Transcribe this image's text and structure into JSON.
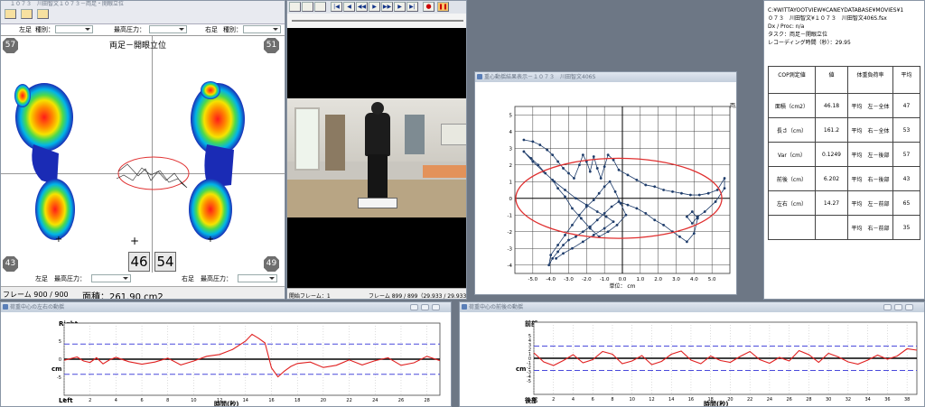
{
  "colors": {
    "accent": "#e02020",
    "track": "#1f3d6b",
    "ellipse": "#e03030",
    "mean": "#000000",
    "band": "#4a4adb",
    "desktop": "#6d7785"
  },
  "foot_window": {
    "title": "１０７３　川田智文１０７３－両足・開眼立位",
    "toolbar_icons": [
      "trace-icon",
      "foot-icon",
      "view-icon"
    ],
    "left_foot_label": "左足",
    "type_label": "種別：",
    "max_pressure_label": "最高圧力：",
    "right_foot_label": "右足",
    "type_label_right": "種別：",
    "display_title": "両足－開眼立位",
    "corner_tl": "57",
    "corner_tr": "51",
    "corner_bl": "43",
    "corner_br": "49",
    "pct_left": "46",
    "pct_right": "54",
    "bottom_left_label": "左足　最高圧力：",
    "bottom_right_label": "右足　最高圧力：",
    "frame_status": "フレーム 900 / 900",
    "area_status": "面積：261.90 cm2"
  },
  "video_window": {
    "controls": [
      "open-icon",
      "copy-icon",
      "save-icon",
      "first-icon",
      "prev-icon",
      "back-icon",
      "play-icon",
      "forward-icon",
      "next-icon",
      "last-icon",
      "record-icon",
      "pause-icon"
    ],
    "start_frame_label": "開始フレーム：1",
    "frame_status": "フレーム 899 / 899（29.933 / 29.933 秒）"
  },
  "cop_window": {
    "title": "重心動揺結果表示－１０７３　川田智文406S",
    "legend": "１０７３\n両足－開眼立位",
    "xlabel": "単位： cm",
    "chart_data": {
      "type": "scatter",
      "title": "",
      "xlabel": "単位： cm",
      "ylabel": "",
      "xlim": [
        -6,
        6
      ],
      "ylim": [
        -4.5,
        5.5
      ],
      "xticks": [
        -5,
        -4,
        -3,
        -2,
        -1,
        0,
        1,
        2,
        3,
        4,
        5
      ],
      "yticks": [
        5,
        4,
        3,
        2,
        1,
        0,
        -1,
        -2,
        -3,
        -4
      ],
      "grid": true,
      "ellipse": {
        "cx": -0.2,
        "cy": 0,
        "rx": 5.75,
        "ry": 2.4
      },
      "x": [
        -5.5,
        -5.0,
        -4.6,
        -4.2,
        -3.9,
        -3.6,
        -3.3,
        -3.0,
        -2.7,
        -2.4,
        -2.2,
        -2.0,
        -1.8,
        -1.6,
        -1.4,
        -1.2,
        -1.0,
        -0.8,
        -0.5,
        -0.2,
        0.3,
        0.8,
        1.3,
        1.8,
        2.3,
        2.8,
        3.3,
        3.8,
        4.3,
        4.8,
        5.3,
        5.7,
        5.7,
        5.2,
        4.6,
        4.2,
        3.9,
        3.6,
        3.9,
        4.2,
        4.0,
        3.6,
        3.2,
        2.8,
        2.3,
        1.8,
        1.3,
        0.8,
        0.3,
        -0.2,
        -0.6,
        -1.0,
        -1.4,
        -1.8,
        -2.2,
        -2.6,
        -3.0,
        -3.3,
        -3.6,
        -3.9,
        -4.1,
        -4.0,
        -3.6,
        -3.2,
        -2.8,
        -2.4,
        -2.0,
        -1.6,
        -1.3,
        -1.0,
        -0.7,
        -0.4,
        -0.1,
        0.2,
        -0.3,
        -0.8,
        -1.3,
        -1.8,
        -2.3,
        -2.8,
        -3.2,
        -3.6,
        -3.9,
        -4.3,
        -4.7,
        -5.1,
        -5.5,
        -5.0,
        -4.4,
        -3.8,
        -3.2,
        -2.6,
        -2.0,
        -1.4,
        -0.9,
        -0.5,
        -1.0,
        -1.6,
        -2.2,
        -2.8,
        -3.3,
        -3.7
      ],
      "y": [
        3.5,
        3.4,
        3.2,
        2.9,
        2.6,
        2.2,
        1.8,
        1.5,
        1.2,
        2.0,
        2.6,
        2.2,
        1.6,
        2.5,
        1.8,
        1.2,
        1.9,
        2.6,
        2.3,
        1.7,
        1.4,
        1.1,
        0.8,
        0.7,
        0.5,
        0.4,
        0.3,
        0.2,
        0.2,
        0.3,
        0.5,
        1.2,
        0.6,
        -0.2,
        -0.8,
        -1.1,
        -1.5,
        -1.1,
        -0.8,
        -1.2,
        -2.1,
        -2.6,
        -2.3,
        -2.0,
        -1.6,
        -1.3,
        -0.9,
        -0.6,
        -0.4,
        -0.2,
        -0.5,
        -0.9,
        -1.3,
        -1.7,
        -2.0,
        -2.3,
        -2.5,
        -2.8,
        -3.2,
        -3.6,
        -4.0,
        -3.4,
        -2.8,
        -2.2,
        -1.6,
        -1.0,
        -0.5,
        -0.1,
        0.3,
        0.7,
        1.0,
        0.4,
        -0.3,
        -1.0,
        -1.6,
        -2.0,
        -2.3,
        -1.8,
        -1.2,
        -0.6,
        0.1,
        0.6,
        1.1,
        1.5,
        2.0,
        2.4,
        2.8,
        2.2,
        1.6,
        1.0,
        0.5,
        0.0,
        -0.4,
        -0.8,
        -1.1,
        -1.4,
        -1.8,
        -2.2,
        -2.6,
        -3.0,
        -3.3,
        -3.6
      ]
    }
  },
  "results_window": {
    "header_lines": [
      "C:¥WITTAYOOTVIEW¥CANEYDATABASE¥MOVIES¥1",
      "０７３　川田智文¥１０７３　川田智文406S.fsx",
      "Dx / Proc: n/a",
      "タスク：両足－開眼立位",
      "レコーディング時間（秒）：29.95"
    ],
    "columns": [
      "COP測定値",
      "値",
      "体重負荷率",
      "平均"
    ],
    "rows": [
      [
        "面積（cm2）",
        "46.18",
        "平均　左－全体",
        "47"
      ],
      [
        "長さ（cm）",
        "161.2",
        "平均　右－全体",
        "53"
      ],
      [
        "Var（cm）",
        "0.1249",
        "平均　左－後部",
        "57"
      ],
      [
        "前後（cm）",
        "6.202",
        "平均　右－後部",
        "43"
      ],
      [
        "左右（cm）",
        "14.27",
        "平均　左－前部",
        "65"
      ],
      [
        "",
        "",
        "平均　右－前部",
        "35"
      ]
    ]
  },
  "lr_window": {
    "title": "荷重中心の左右の動揺",
    "top_label": "Right",
    "bottom_label": "Left",
    "ylabel": "cm",
    "xlabel": "時間(秒)",
    "chart_data": {
      "type": "line",
      "title": "",
      "xlabel": "時間(秒)",
      "ylabel": "cm",
      "xlim": [
        0,
        29
      ],
      "ylim": [
        -10,
        10
      ],
      "xticks": [
        0,
        2,
        4,
        6,
        8,
        10,
        12,
        14,
        16,
        18,
        20,
        22,
        24,
        26,
        28
      ],
      "yticks": [
        5,
        0,
        -5
      ],
      "upper_band": 4.2,
      "lower_band": -4.2,
      "series": [
        {
          "x": [
            0,
            1,
            1.5,
            2,
            2.5,
            3,
            3.5,
            4,
            5,
            6,
            7,
            8,
            9,
            10,
            11,
            12,
            13,
            14,
            14.5,
            15,
            15.5,
            16,
            16.5,
            17,
            17.5,
            18,
            19,
            20,
            21,
            22,
            23,
            24,
            25,
            26,
            27,
            28,
            29
          ],
          "y": [
            -0.3,
            0.6,
            -0.5,
            -0.9,
            0.4,
            -1.3,
            -0.2,
            0.5,
            -0.7,
            -1.4,
            -0.8,
            0.3,
            -1.6,
            -0.5,
            0.8,
            1.3,
            2.7,
            5.0,
            6.9,
            5.8,
            4.5,
            -2.4,
            -4.9,
            -3.3,
            -2.0,
            -1.2,
            -0.8,
            -2.3,
            -1.7,
            -0.2,
            -1.6,
            -0.4,
            0.4,
            -1.7,
            -1.0,
            0.8,
            -0.4
          ]
        }
      ]
    }
  },
  "ap_window": {
    "title": "荷重中心の前後の動揺",
    "top_label": "前部",
    "bottom_label": "後部",
    "ylabel": "cm",
    "xlabel": "時間(秒)",
    "chart_data": {
      "type": "line",
      "title": "",
      "xlabel": "時間(秒)",
      "ylabel": "cm",
      "xlim": [
        0,
        39
      ],
      "ylim": [
        -8,
        8
      ],
      "xticks": [
        0,
        2,
        4,
        6,
        8,
        10,
        12,
        14,
        16,
        18,
        20,
        22,
        24,
        26,
        28,
        30,
        32,
        34,
        36,
        38
      ],
      "yticks": [
        5,
        4,
        3,
        2,
        1,
        0,
        -1,
        -2,
        -3,
        -4,
        -5
      ],
      "upper_band": 2.7,
      "lower_band": -2.7,
      "series": [
        {
          "x": [
            0,
            1,
            2,
            3,
            4,
            5,
            6,
            7,
            8,
            9,
            10,
            11,
            12,
            13,
            14,
            15,
            16,
            17,
            18,
            19,
            20,
            21,
            22,
            23,
            24,
            25,
            26,
            27,
            28,
            29,
            30,
            31,
            32,
            33,
            34,
            35,
            36,
            37,
            38,
            39
          ],
          "y": [
            1.2,
            -0.8,
            -1.6,
            -0.5,
            0.8,
            -1.0,
            -0.3,
            1.5,
            0.9,
            -1.2,
            -0.6,
            0.6,
            -1.4,
            -0.7,
            0.9,
            1.6,
            -0.4,
            -1.2,
            0.5,
            -0.5,
            -0.9,
            0.4,
            1.5,
            -0.3,
            -1.1,
            0.2,
            -0.6,
            1.7,
            0.8,
            -0.9,
            1.1,
            0.3,
            -0.8,
            -1.3,
            -0.4,
            0.7,
            -0.2,
            0.5,
            2.1,
            1.8
          ]
        }
      ]
    }
  }
}
